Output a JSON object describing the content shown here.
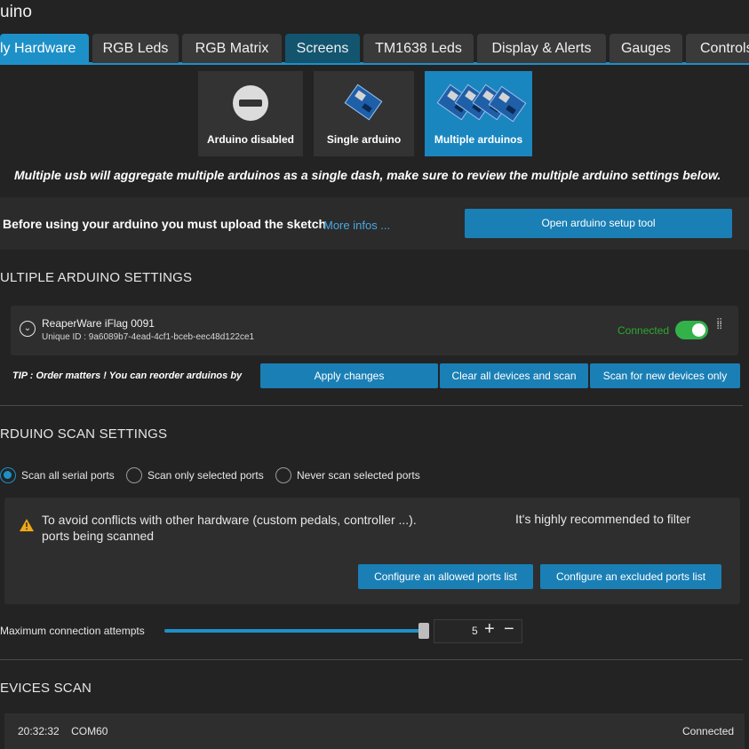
{
  "window": {
    "title": "uino"
  },
  "tabs": [
    {
      "label": "ly Hardware",
      "active": true
    },
    {
      "label": "RGB Leds"
    },
    {
      "label": "RGB Matrix"
    },
    {
      "label": "Screens"
    },
    {
      "label": "TM1638 Leds"
    },
    {
      "label": "Display & Alerts"
    },
    {
      "label": "Gauges"
    },
    {
      "label": "Controls"
    }
  ],
  "modes": [
    {
      "label": "Arduino disabled",
      "icon": "no-entry-icon"
    },
    {
      "label": "Single arduino",
      "icon": "arduino-board-icon"
    },
    {
      "label": "Multiple arduinos",
      "icon": "arduino-boards-icon",
      "selected": true
    }
  ],
  "multi_note": "Multiple usb will aggregate multiple arduinos as a single dash, make sure to review the multiple arduino settings below.",
  "sketch": {
    "text": "Before using your arduino you must upload the sketch",
    "link": "More infos ...",
    "button": "Open arduino setup tool"
  },
  "multiple_settings": {
    "title": "ULTIPLE ARDUINO SETTINGS",
    "device": {
      "name": "ReaperWare iFlag 0091",
      "uid": "Unique ID : 9a6089b7-4ead-4cf1-bceb-eec48d122ce1",
      "status": "Connected",
      "enabled": true
    },
    "tip": "TIP : Order matters ! You can reorder arduinos by",
    "buttons": {
      "apply": "Apply changes",
      "clear": "Clear all devices and scan",
      "scan_new": "Scan for new devices only"
    }
  },
  "scan_settings": {
    "title": "RDUINO SCAN SETTINGS",
    "options": [
      {
        "label": "Scan all serial ports",
        "selected": true
      },
      {
        "label": "Scan only selected ports"
      },
      {
        "label": "Never scan selected ports"
      }
    ],
    "warning": {
      "line1": "To avoid conflicts with other hardware (custom pedals, controller ...).",
      "line2": "ports being scanned",
      "right": "It's highly recommended to filter"
    },
    "buttons": {
      "allowed": "Configure an allowed ports list",
      "excluded": "Configure an excluded ports list"
    },
    "max_attempts": {
      "label": "Maximum connection attempts",
      "value": "5",
      "plus": "+",
      "minus": "−"
    }
  },
  "devices_scan": {
    "title": "EVICES SCAN",
    "log": {
      "time": "20:32:32",
      "port": "COM60",
      "status": "Connected"
    }
  },
  "colors": {
    "accent": "#1e90c8",
    "button": "#1a7fb5",
    "connected": "#33b24a",
    "background": "#232323"
  }
}
